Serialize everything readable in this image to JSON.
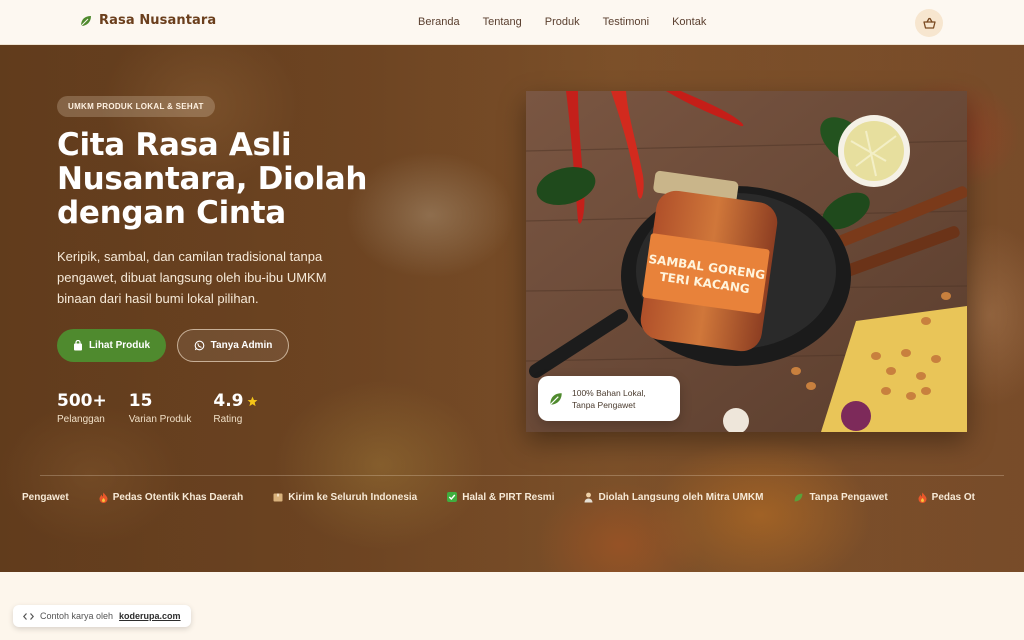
{
  "brand": {
    "name": "Rasa Nusantara",
    "icon": "leaf-icon"
  },
  "nav": {
    "items": [
      {
        "label": "Beranda"
      },
      {
        "label": "Tentang"
      },
      {
        "label": "Produk"
      },
      {
        "label": "Testimoni"
      },
      {
        "label": "Kontak"
      }
    ],
    "cart_icon": "shopping-basket-icon"
  },
  "hero": {
    "tag": "UMKM PRODUK LOKAL & SEHAT",
    "title": "Cita Rasa Asli Nusantara, Diolah dengan Cinta",
    "subtitle": "Keripik, sambal, dan camilan tradisional tanpa pengawet, dibuat langsung oleh ibu-ibu UMKM binaan dari hasil bumi lokal pilihan.",
    "primary_button": {
      "label": "Lihat Produk",
      "icon": "bag-icon"
    },
    "secondary_button": {
      "label": "Tanya Admin",
      "icon": "whatsapp-icon"
    },
    "stats": [
      {
        "value": "500+",
        "label": "Pelanggan"
      },
      {
        "value": "15",
        "label": "Varian Produk"
      },
      {
        "value": "4.9",
        "label": "Rating",
        "icon": "star-icon"
      }
    ],
    "product_image": {
      "jar_label_line1": "SAMBAL GORENG",
      "jar_label_line2": "TERI KACANG"
    },
    "image_badge": {
      "line1": "100% Bahan Lokal,",
      "line2": "Tanpa Pengawet",
      "icon": "leaf-icon"
    }
  },
  "marquee": {
    "items": [
      {
        "label": "Pengawet",
        "icon": ""
      },
      {
        "label": "Pedas Otentik Khas Daerah",
        "icon": "fire-icon"
      },
      {
        "label": "Kirim ke Seluruh Indonesia",
        "icon": "package-icon"
      },
      {
        "label": "Halal & PIRT Resmi",
        "icon": "check-box-icon"
      },
      {
        "label": "Diolah Langsung oleh Mitra UMKM",
        "icon": "person-icon"
      },
      {
        "label": "Tanpa Pengawet",
        "icon": "leaf-icon"
      },
      {
        "label": "Pedas Ot",
        "icon": "fire-icon"
      }
    ]
  },
  "credit": {
    "prefix": "Contoh karya oleh",
    "link": "koderupa.com",
    "icon": "code-icon"
  },
  "colors": {
    "brand_brown": "#6b3f1d",
    "primary_green": "#4f8a2e",
    "star": "#f5c518",
    "page_bg": "#fdf6ec"
  }
}
